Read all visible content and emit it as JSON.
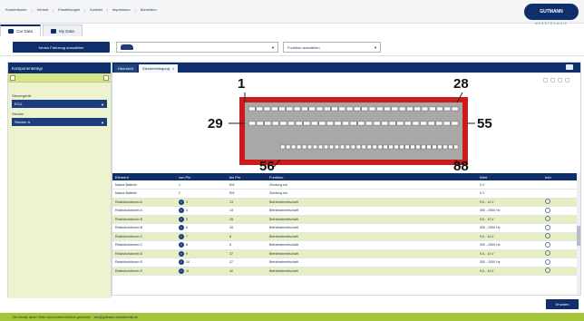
{
  "top_nav": [
    "Kundenkonto",
    "Verlauf",
    "Einstellungen",
    "Kontakt",
    "Impressum",
    "Abmelden"
  ],
  "brand": {
    "name": "GUTMANN",
    "subtitle": "MESSTECHNIK"
  },
  "window_tabs": [
    {
      "label": "Car Data",
      "active": true
    },
    {
      "label": "My Data",
      "active": false
    }
  ],
  "toolbar": {
    "new_vehicle_button": "Neues Fahrzeug auswählen",
    "vehicle_value": "",
    "function_select": "Funktion auswählen"
  },
  "sidebar": {
    "title": "Komponententyp",
    "fields": [
      {
        "label": "Steuergerät",
        "value": "ECU"
      },
      {
        "label": "Stecker",
        "value": "Stecker A"
      }
    ]
  },
  "main_tabs": [
    "Übersicht",
    "Steckerbelegung"
  ],
  "diagram": {
    "pin_labels": [
      "1",
      "28",
      "29",
      "55",
      "56",
      "88"
    ]
  },
  "table": {
    "headers": [
      "Element",
      "von Pin",
      "bis Pin",
      "Funktion",
      "Wert",
      "Info"
    ],
    "rows": [
      {
        "element": "Masse Batterie",
        "von": "1",
        "bis": "EM",
        "funktion": "Zündung ein",
        "wert": "0 V",
        "info": false,
        "style": "white"
      },
      {
        "element": "Masse Batterie",
        "von": "2",
        "bis": "EM",
        "funktion": "Zündung ein",
        "wert": "0 V",
        "info": false,
        "style": "white"
      },
      {
        "element": "Relaisfunktionen A",
        "von": "3",
        "bis": "13",
        "funktion": "Betriebsbereitschaft",
        "wert": "9,5 - 14 V",
        "info": true,
        "style": "green"
      },
      {
        "element": "Relaisfunktionen A",
        "von": "4",
        "bis": "13",
        "funktion": "Betriebsbereitschaft",
        "wert": "300 - 2000 Hz",
        "info": true,
        "style": "white"
      },
      {
        "element": "Relaisfunktionen B",
        "von": "5",
        "bis": "28",
        "funktion": "Betriebsbereitschaft",
        "wert": "9,5 - 14 V",
        "info": true,
        "style": "green"
      },
      {
        "element": "Relaisfunktionen B",
        "von": "6",
        "bis": "28",
        "funktion": "Betriebsbereitschaft",
        "wert": "300 - 2000 Hz",
        "info": true,
        "style": "white"
      },
      {
        "element": "Relaisfunktionen C",
        "von": "7",
        "bis": "8",
        "funktion": "Betriebsbereitschaft",
        "wert": "9,5 - 14 V",
        "info": true,
        "style": "green"
      },
      {
        "element": "Relaisfunktionen C",
        "von": "8",
        "bis": "8",
        "funktion": "Betriebsbereitschaft",
        "wert": "300 - 2000 Hz",
        "info": true,
        "style": "white"
      },
      {
        "element": "Relaisfunktionen D",
        "von": "9",
        "bis": "37",
        "funktion": "Betriebsbereitschaft",
        "wert": "9,5 - 14 V",
        "info": true,
        "style": "green"
      },
      {
        "element": "Relaisfunktionen D",
        "von": "10",
        "bis": "37",
        "funktion": "Betriebsbereitschaft",
        "wert": "300 - 2000 Hz",
        "info": true,
        "style": "white"
      },
      {
        "element": "Relaisfunktionen E",
        "von": "11",
        "bis": "42",
        "funktion": "Betriebsbereitschaft",
        "wert": "9,5 - 14 V",
        "info": true,
        "style": "green"
      }
    ]
  },
  "footer_button": "Drucken",
  "status_bar": {
    "text": "Die Inhalte dieser Seite sind urheberrechtlich geschützt",
    "email": "info@gutmann-messtechnik.de"
  }
}
